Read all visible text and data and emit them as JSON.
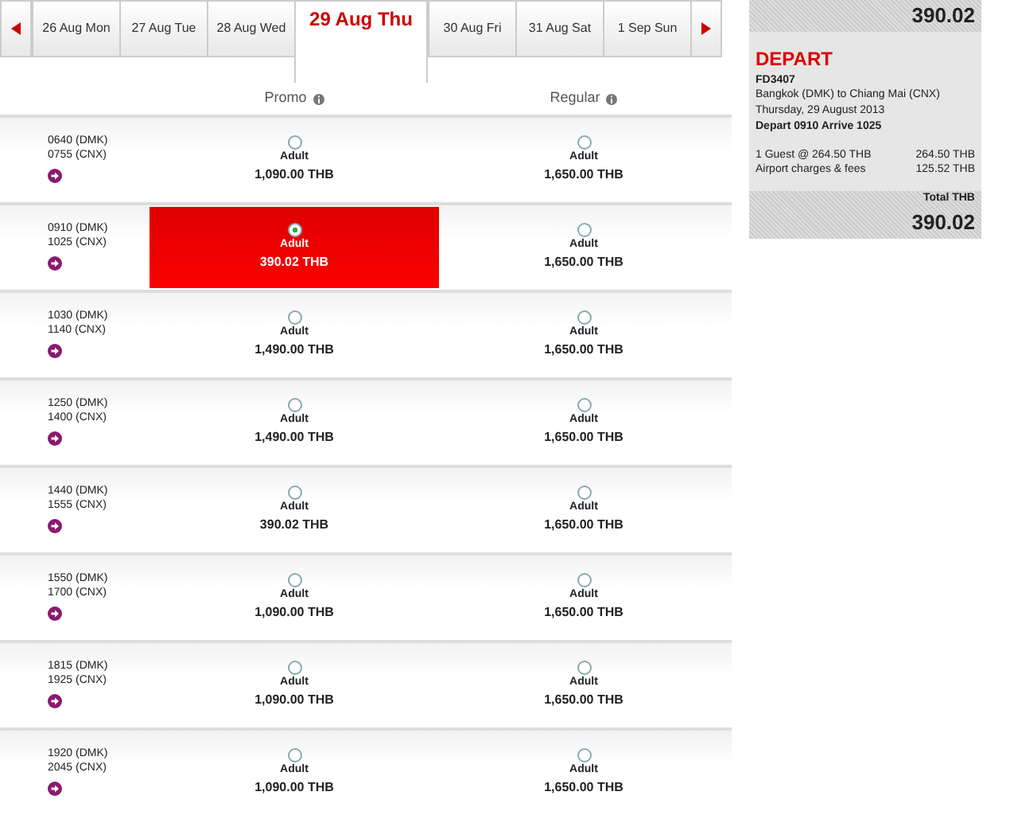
{
  "date_tabs": [
    {
      "label": "26 Aug Mon",
      "selected": false
    },
    {
      "label": "27 Aug Tue",
      "selected": false
    },
    {
      "label": "28 Aug Wed",
      "selected": false
    },
    {
      "label": "29 Aug Thu",
      "selected": true
    },
    {
      "label": "30 Aug Fri",
      "selected": false
    },
    {
      "label": "31 Aug Sat",
      "selected": false
    },
    {
      "label": "1 Sep Sun",
      "selected": false
    }
  ],
  "columns": [
    "Promo",
    "Regular"
  ],
  "flights": [
    {
      "depart": "0640 (DMK)",
      "arrive": "0755 (CNX)",
      "fares": [
        {
          "label": "Adult",
          "price": "1,090.00 THB",
          "selected": false
        },
        {
          "label": "Adult",
          "price": "1,650.00 THB",
          "selected": false
        }
      ]
    },
    {
      "depart": "0910 (DMK)",
      "arrive": "1025 (CNX)",
      "fares": [
        {
          "label": "Adult",
          "price": "390.02 THB",
          "selected": true
        },
        {
          "label": "Adult",
          "price": "1,650.00 THB",
          "selected": false
        }
      ]
    },
    {
      "depart": "1030 (DMK)",
      "arrive": "1140 (CNX)",
      "fares": [
        {
          "label": "Adult",
          "price": "1,490.00 THB",
          "selected": false
        },
        {
          "label": "Adult",
          "price": "1,650.00 THB",
          "selected": false
        }
      ]
    },
    {
      "depart": "1250 (DMK)",
      "arrive": "1400 (CNX)",
      "fares": [
        {
          "label": "Adult",
          "price": "1,490.00 THB",
          "selected": false
        },
        {
          "label": "Adult",
          "price": "1,650.00 THB",
          "selected": false
        }
      ]
    },
    {
      "depart": "1440 (DMK)",
      "arrive": "1555 (CNX)",
      "fares": [
        {
          "label": "Adult",
          "price": "390.02 THB",
          "selected": false
        },
        {
          "label": "Adult",
          "price": "1,650.00 THB",
          "selected": false
        }
      ]
    },
    {
      "depart": "1550 (DMK)",
      "arrive": "1700 (CNX)",
      "fares": [
        {
          "label": "Adult",
          "price": "1,090.00 THB",
          "selected": false
        },
        {
          "label": "Adult",
          "price": "1,650.00 THB",
          "selected": false
        }
      ]
    },
    {
      "depart": "1815 (DMK)",
      "arrive": "1925 (CNX)",
      "fares": [
        {
          "label": "Adult",
          "price": "1,090.00 THB",
          "selected": false
        },
        {
          "label": "Adult",
          "price": "1,650.00 THB",
          "selected": false
        }
      ]
    },
    {
      "depart": "1920 (DMK)",
      "arrive": "2045 (CNX)",
      "fares": [
        {
          "label": "Adult",
          "price": "1,090.00 THB",
          "selected": false
        },
        {
          "label": "Adult",
          "price": "1,650.00 THB",
          "selected": false
        }
      ]
    }
  ],
  "summary": {
    "top_total_amount": "390.02",
    "heading": "DEPART",
    "flight_number": "FD3407",
    "route": "Bangkok (DMK) to Chiang Mai (CNX)",
    "date": "Thursday, 29 August 2013",
    "times": "Depart 0910 Arrive 1025",
    "lines": [
      {
        "label": "1 Guest @ 264.50 THB",
        "amount": "264.50 THB"
      },
      {
        "label": "Airport charges & fees",
        "amount": "125.52 THB"
      }
    ],
    "total_label": "Total THB",
    "total_amount": "390.02"
  }
}
